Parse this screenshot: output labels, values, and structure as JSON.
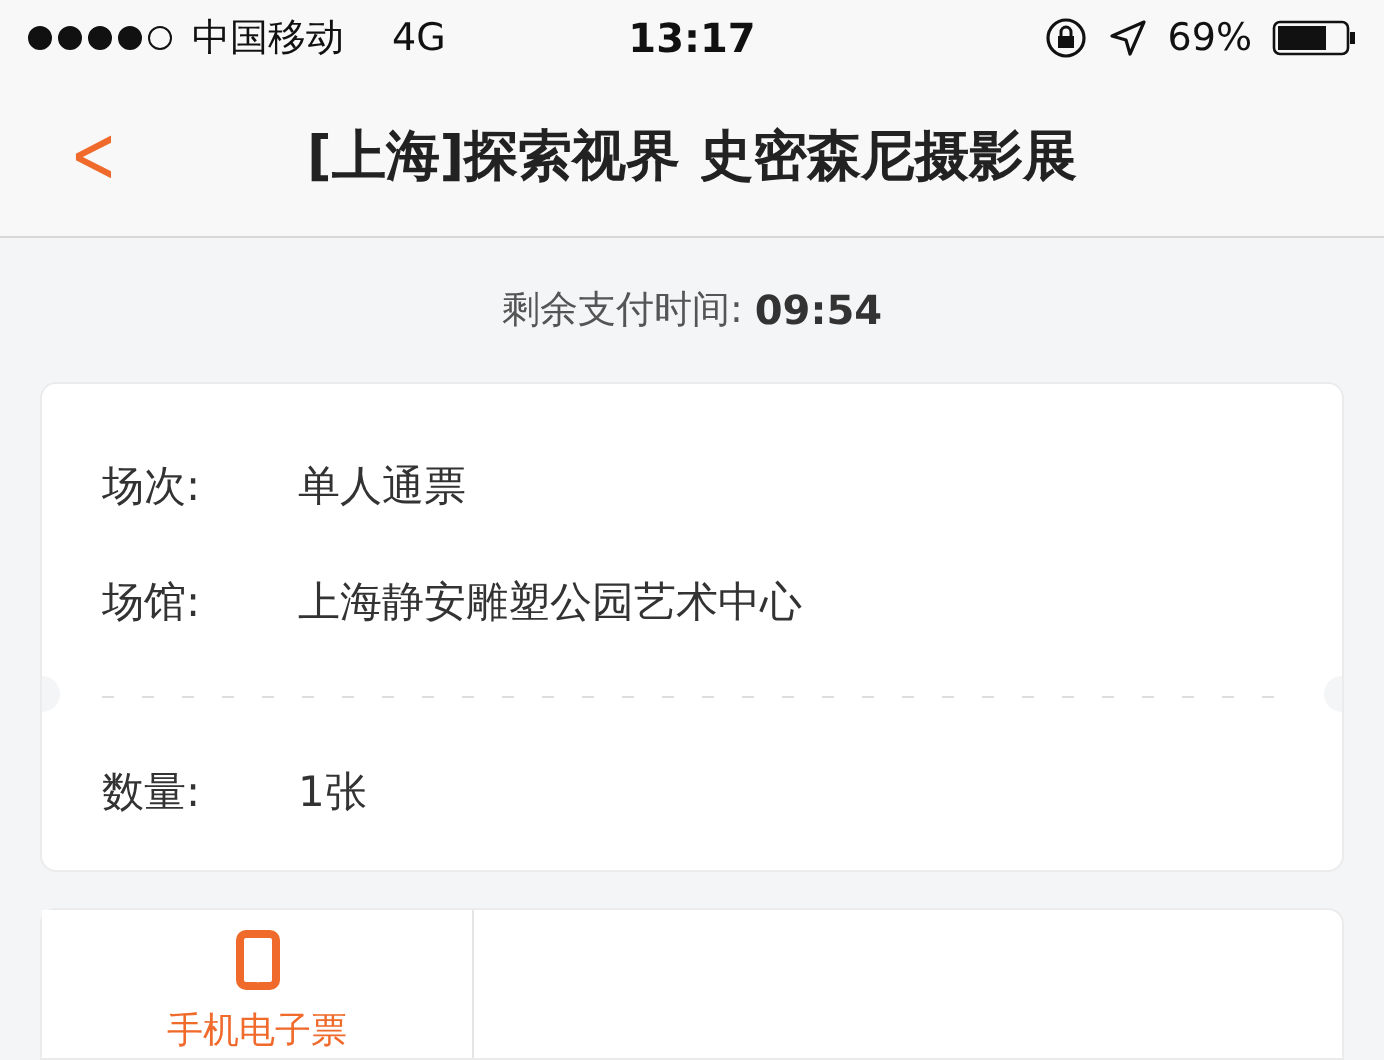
{
  "status_bar": {
    "carrier": "中国移动",
    "network": "4G",
    "time": "13:17",
    "battery": "69%"
  },
  "nav": {
    "back": "<",
    "title": "[上海]探索视界 史密森尼摄影展"
  },
  "countdown": {
    "label": "剩余支付时间:",
    "value": "09:54"
  },
  "ticket": {
    "rows": [
      {
        "label": "场次:",
        "value": "单人通票"
      },
      {
        "label": "场馆:",
        "value": "上海静安雕塑公园艺术中心"
      }
    ],
    "quantity": {
      "label": "数量:",
      "value": "1张"
    }
  },
  "delivery": [
    {
      "label": "手机电子票",
      "selected": true
    }
  ]
}
